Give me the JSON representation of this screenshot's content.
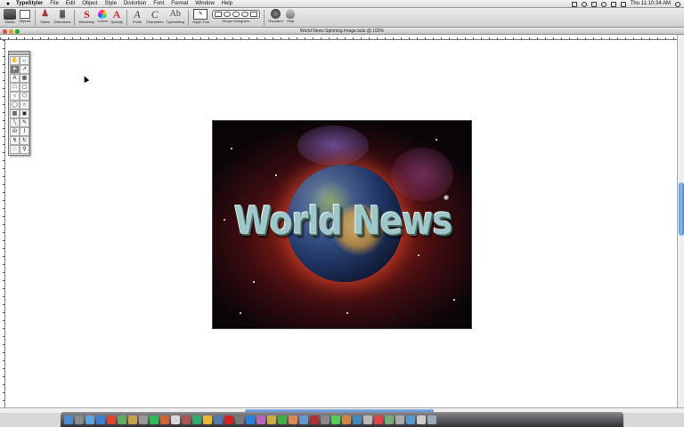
{
  "menubar": {
    "apple": "",
    "items": [
      "TypeStyler",
      "File",
      "Edit",
      "Object",
      "Style",
      "Distortion",
      "Font",
      "Format",
      "Window",
      "Help"
    ],
    "clock": "Thu 11:10:34 AM"
  },
  "toolbar": {
    "tools": [
      {
        "label": "Media",
        "icon": "media-icon"
      },
      {
        "label": "Objects",
        "icon": "objects-icon"
      },
      {
        "label": "Styles",
        "icon": "styles-icon"
      },
      {
        "label": "Distortions",
        "icon": "distortions-icon"
      },
      {
        "label": "Workshop",
        "icon": "workshop-icon",
        "glyph": "S"
      },
      {
        "label": "Colors",
        "icon": "colors-icon"
      },
      {
        "label": "Opacity",
        "icon": "opacity-icon",
        "glyph": "A"
      },
      {
        "label": "Fonts",
        "icon": "fonts-icon",
        "glyph": "A"
      },
      {
        "label": "Characters",
        "icon": "characters-icon",
        "glyph": "C"
      },
      {
        "label": "Typesetting",
        "icon": "typesetting-icon",
        "glyph": "Ab"
      },
      {
        "label": "Glyph Tool",
        "icon": "glyph-tool-icon"
      },
      {
        "label": "Shape Designers",
        "icon": "shape-designers-icon"
      },
      {
        "label": "Visualizer",
        "icon": "visualizer-icon"
      },
      {
        "label": "Help",
        "icon": "help-icon"
      }
    ]
  },
  "document": {
    "title": "World News Spinning Image.tsdx @ 100%"
  },
  "artwork": {
    "headline": "World News"
  },
  "palette": {
    "tools": [
      "",
      "",
      "",
      "",
      "A",
      "",
      "",
      "",
      "",
      "",
      "",
      "",
      "",
      "",
      "",
      "",
      "",
      "",
      "",
      "",
      "",
      "",
      "",
      ""
    ]
  },
  "colors": {
    "scroll_accent": "#5f95d8",
    "nebula_red": "#b0281e",
    "headline": "#9fc6c9"
  }
}
